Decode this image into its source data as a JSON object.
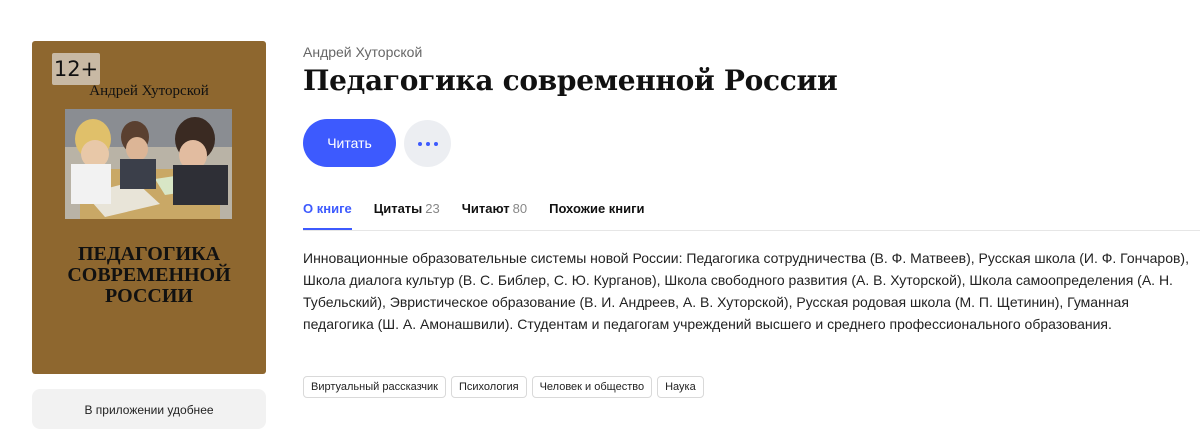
{
  "cover": {
    "age_rating": "12+",
    "author": "Андрей Хуторской",
    "title_lines": [
      "ПЕДАГОГИКА",
      "СОВРЕМЕННОЙ",
      "РОССИИ"
    ],
    "background": "#8e672f"
  },
  "app_promo": {
    "text": "В приложении удобнее"
  },
  "book": {
    "author": "Андрей Хуторской",
    "title": "Педагогика современной России"
  },
  "actions": {
    "read_label": "Читать",
    "more_icon": "more-dots-icon",
    "accent": "#3d5afe"
  },
  "tabs": [
    {
      "label": "О книге",
      "count": ""
    },
    {
      "label": "Цитаты",
      "count": "23"
    },
    {
      "label": "Читают",
      "count": "80"
    },
    {
      "label": "Похожие книги",
      "count": ""
    }
  ],
  "description": "Инновационные образовательные системы новой России: Педагогика сотрудничества (В. Ф. Матвеев), Русская школа (И. Ф. Гончаров), Школа диалога культур (В. С. Библер, С. Ю. Курганов), Школа свободного развития (А. В. Хуторской), Школа самоопределения (А. Н. Тубельский), Эвристическое образование (В. И. Андреев, А. В. Хуторской), Русская родовая школа (М. П. Щетинин), Гуманная педагогика (Ш. А. Амонашвили). Студентам и педагогам учреждений высшего и среднего профессионального образования.",
  "tags": [
    "Виртуальный рассказчик",
    "Психология",
    "Человек и общество",
    "Наука"
  ]
}
